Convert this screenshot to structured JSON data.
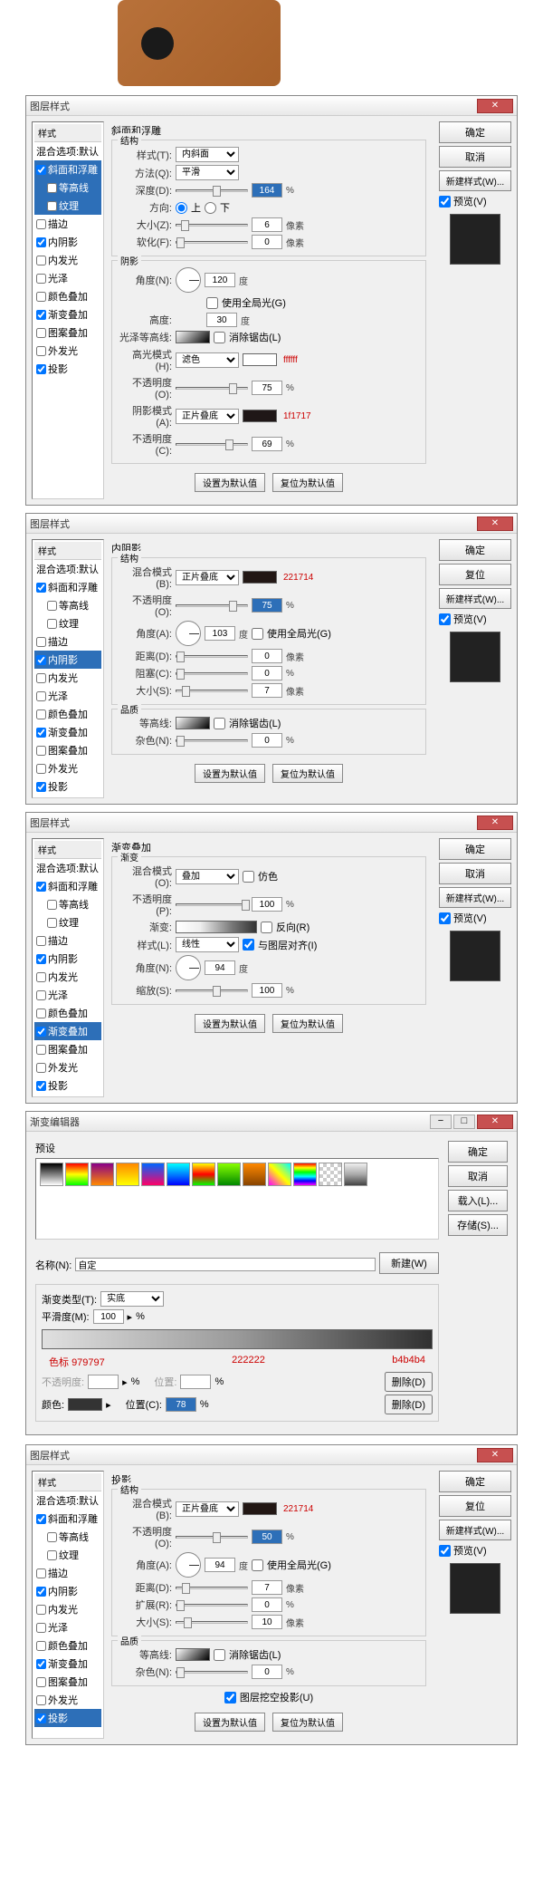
{
  "window_title": "图层样式",
  "sidebar": {
    "header": "样式",
    "blend_options": "混合选项:默认",
    "items": [
      "斜面和浮雕",
      "等高线",
      "纹理",
      "描边",
      "内阴影",
      "内发光",
      "光泽",
      "颜色叠加",
      "渐变叠加",
      "图案叠加",
      "外发光",
      "投影"
    ]
  },
  "buttons": {
    "ok": "确定",
    "cancel": "取消",
    "reset": "复位",
    "new_style": "新建样式(W)...",
    "preview": "预览(V)",
    "default": "设置为默认值",
    "reset_default": "复位为默认值"
  },
  "panel1": {
    "title": "斜面和浮雕",
    "struct": "结构",
    "style_lbl": "样式(T):",
    "style_val": "内斜面",
    "method_lbl": "方法(Q):",
    "method_val": "平滑",
    "depth_lbl": "深度(D):",
    "depth_val": "164",
    "depth_unit": "%",
    "dir_lbl": "方向:",
    "dir_up": "上",
    "dir_down": "下",
    "size_lbl": "大小(Z):",
    "size_val": "6",
    "size_unit": "像素",
    "soften_lbl": "软化(F):",
    "soften_val": "0",
    "soften_unit": "像素",
    "shadow_title": "阴影",
    "angle_lbl": "角度(N):",
    "angle_val": "120",
    "angle_unit": "度",
    "global_light": "使用全局光(G)",
    "altitude_lbl": "高度:",
    "altitude_val": "30",
    "altitude_unit": "度",
    "gloss_lbl": "光泽等高线:",
    "antialias": "消除锯齿(L)",
    "highlight_lbl": "高光模式(H):",
    "highlight_val": "滤色",
    "highlight_hex": "ffffff",
    "highlight_op_lbl": "不透明度(O):",
    "highlight_op": "75",
    "pct": "%",
    "shadow_mode_lbl": "阴影模式(A):",
    "shadow_mode_val": "正片叠底",
    "shadow_hex": "1f1717",
    "shadow_op_lbl": "不透明度(C):",
    "shadow_op": "69"
  },
  "panel2": {
    "title": "内阴影",
    "struct": "结构",
    "blend_lbl": "混合模式(B):",
    "blend_val": "正片叠底",
    "hex": "221714",
    "op_lbl": "不透明度(O):",
    "op_val": "75",
    "pct": "%",
    "angle_lbl": "角度(A):",
    "angle_val": "103",
    "angle_unit": "度",
    "global": "使用全局光(G)",
    "dist_lbl": "距离(D):",
    "dist_val": "0",
    "px": "像素",
    "choke_lbl": "阻塞(C):",
    "choke_val": "0",
    "size_lbl": "大小(S):",
    "size_val": "7",
    "quality": "品质",
    "contour_lbl": "等高线:",
    "antialias": "消除锯齿(L)",
    "noise_lbl": "杂色(N):",
    "noise_val": "0"
  },
  "panel3": {
    "title": "渐变叠加",
    "grad": "渐变",
    "blend_lbl": "混合模式(O):",
    "blend_val": "叠加",
    "dither": "仿色",
    "op_lbl": "不透明度(P):",
    "op_val": "100",
    "pct": "%",
    "grad_lbl": "渐变:",
    "reverse": "反向(R)",
    "style_lbl": "样式(L):",
    "style_val": "线性",
    "align": "与图层对齐(I)",
    "angle_lbl": "角度(N):",
    "angle_val": "94",
    "angle_unit": "度",
    "scale_lbl": "缩放(S):",
    "scale_val": "100"
  },
  "grad_editor": {
    "title": "渐变编辑器",
    "presets": "预设",
    "ok": "确定",
    "cancel": "取消",
    "load": "载入(L)...",
    "save": "存储(S)...",
    "name_lbl": "名称(N):",
    "name_val": "自定",
    "new_btn": "新建(W)",
    "type_lbl": "渐变类型(T):",
    "type_val": "实底",
    "smooth_lbl": "平滑度(M):",
    "smooth_val": "100",
    "pct": "%",
    "stops_lbl": "色标",
    "stop1": "979797",
    "stop2": "222222",
    "stop3": "b4b4b4",
    "opacity_lbl": "不透明度:",
    "pos_lbl": "位置:",
    "del": "删除(D)",
    "color_lbl": "颜色:",
    "pos2_lbl": "位置(C):",
    "pos2_val": "78"
  },
  "panel4": {
    "title": "投影",
    "struct": "结构",
    "blend_lbl": "混合模式(B):",
    "blend_val": "正片叠底",
    "hex": "221714",
    "op_lbl": "不透明度(O):",
    "op_val": "50",
    "pct": "%",
    "angle_lbl": "角度(A):",
    "angle_val": "94",
    "angle_unit": "度",
    "global": "使用全局光(G)",
    "dist_lbl": "距离(D):",
    "dist_val": "7",
    "px": "像素",
    "spread_lbl": "扩展(R):",
    "spread_val": "0",
    "size_lbl": "大小(S):",
    "size_val": "10",
    "quality": "品质",
    "contour_lbl": "等高线:",
    "antialias": "消除锯齿(L)",
    "noise_lbl": "杂色(N):",
    "noise_val": "0",
    "knockout": "图层挖空投影(U)"
  }
}
